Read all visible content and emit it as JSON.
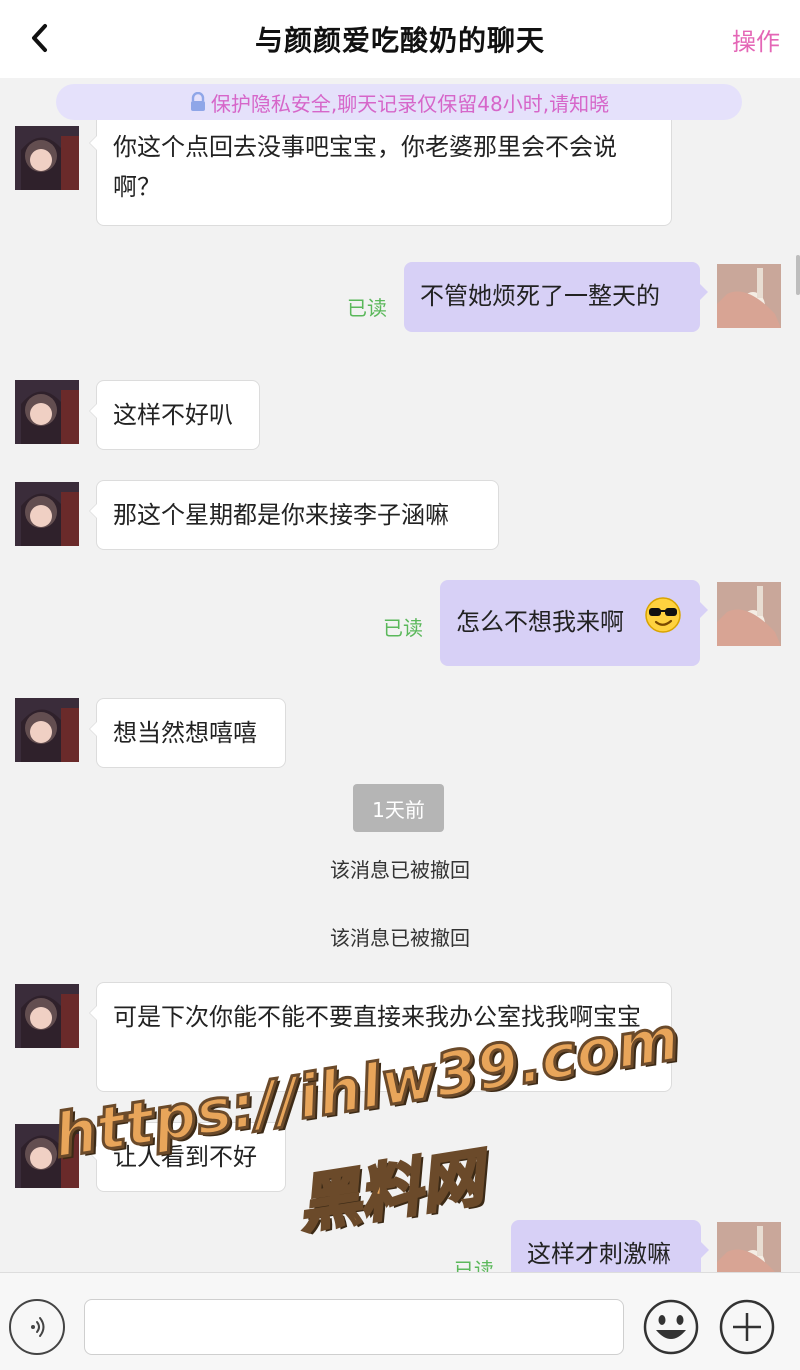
{
  "header": {
    "title": "与颜颜爱吃酸奶的聊天",
    "action_label": "操作"
  },
  "notice": {
    "text": "保护隐私安全,聊天记录仅保留48小时,请知晓"
  },
  "messages": [
    {
      "side": "left",
      "text": "你这个点回去没事吧宝宝，你老婆那里会不会说啊？"
    },
    {
      "side": "right",
      "text": "不管她烦死了一整天的",
      "status": "已读"
    },
    {
      "side": "left",
      "text": "这样不好叭"
    },
    {
      "side": "left",
      "text": "那这个星期都是你来接李子涵嘛"
    },
    {
      "side": "right",
      "text": "怎么不想我来啊",
      "status": "已读",
      "emoji": "sunglasses-emoji"
    },
    {
      "side": "left",
      "text": "想当然想嘻嘻"
    },
    {
      "type": "time",
      "text": "1天前"
    },
    {
      "type": "system",
      "text": "该消息已被撤回"
    },
    {
      "type": "system",
      "text": "该消息已被撤回"
    },
    {
      "side": "left",
      "text": "可是下次你能不能不要直接来我办公室找我啊宝宝"
    },
    {
      "side": "left",
      "text": "让人看到不好"
    },
    {
      "side": "right",
      "text": "这样才刺激嘛",
      "status": "已读"
    }
  ],
  "watermark": {
    "line1": "https://ihlw39.com",
    "line2": "黑料网"
  },
  "input": {
    "value": "",
    "placeholder": ""
  },
  "icons": {
    "back": "chevron-left-icon",
    "voice": "voice-icon",
    "emoji": "smiley-icon",
    "plus": "plus-icon",
    "lock": "lock-icon"
  },
  "colors": {
    "accent_pink": "#e466b6",
    "notice_bg": "#e5e1fb",
    "notice_text": "#d666c9",
    "sent_bubble": "#d7d0f6",
    "read_green": "#5bb85b",
    "time_pill": "#b5b5b5"
  }
}
